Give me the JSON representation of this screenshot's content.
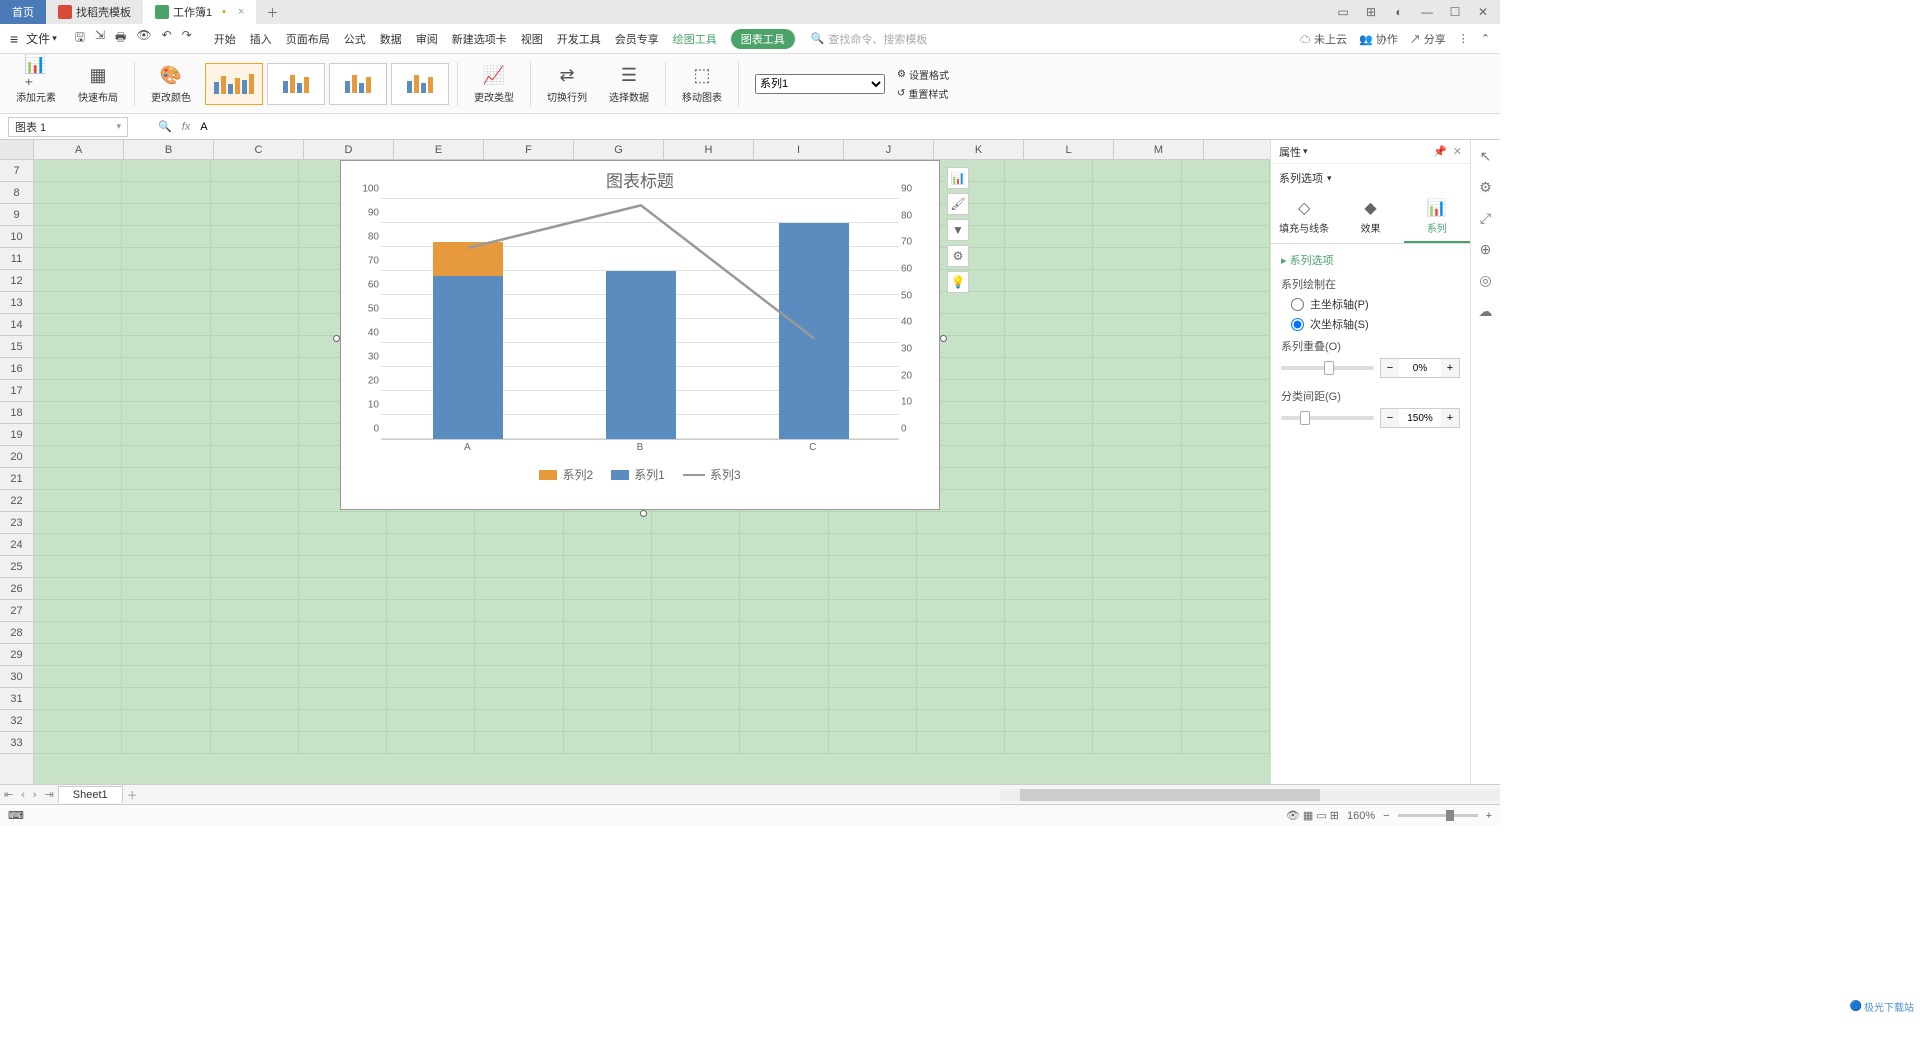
{
  "titlebar": {
    "tabs": [
      {
        "label": "首页",
        "active": true
      },
      {
        "label": "找稻壳模板",
        "icon": "red"
      },
      {
        "label": "工作簿1",
        "icon": "green",
        "modified": true
      }
    ]
  },
  "menubar": {
    "file": "文件",
    "tabs": [
      "开始",
      "插入",
      "页面布局",
      "公式",
      "数据",
      "审阅",
      "新建选项卡",
      "视图",
      "开发工具",
      "会员专享"
    ],
    "context1": "绘图工具",
    "context2": "图表工具",
    "search_placeholder": "查找命令、搜索模板",
    "cloud": "未上云",
    "coop": "协作",
    "share": "分享"
  },
  "ribbon": {
    "add_element": "添加元素",
    "quick_layout": "快速布局",
    "change_color": "更改颜色",
    "change_type": "更改类型",
    "switch_rc": "切换行列",
    "select_data": "选择数据",
    "move_chart": "移动图表",
    "set_format": "设置格式",
    "reset_style": "重置样式",
    "series_selected": "系列1"
  },
  "formula": {
    "name": "图表 1",
    "value": "A"
  },
  "columns": [
    "A",
    "B",
    "C",
    "D",
    "E",
    "F",
    "G",
    "H",
    "I",
    "J",
    "K",
    "L",
    "M"
  ],
  "rows_start": 7,
  "rows_end": 33,
  "chart_data": {
    "type": "bar",
    "title": "图表标题",
    "categories": [
      "A",
      "B",
      "C"
    ],
    "y_ticks": [
      0,
      10,
      20,
      30,
      40,
      50,
      60,
      70,
      80,
      90,
      100
    ],
    "y2_ticks": [
      0,
      10,
      20,
      30,
      40,
      50,
      60,
      70,
      80,
      90
    ],
    "series": [
      {
        "name": "系列2",
        "type": "bar",
        "color": "#e69a3c",
        "values": [
          82,
          70,
          90
        ]
      },
      {
        "name": "系列1",
        "type": "bar",
        "color": "#5b8cc0",
        "values": [
          68,
          70,
          90
        ]
      },
      {
        "name": "系列3",
        "type": "line",
        "color": "#999",
        "values": [
          72,
          88,
          38
        ],
        "axis": "secondary"
      }
    ],
    "legend": [
      "系列2",
      "系列1",
      "系列3"
    ]
  },
  "chart_tools": [
    "chart-elements",
    "brush",
    "filter",
    "gear",
    "lightbulb"
  ],
  "props": {
    "title": "属性",
    "dropdown": "系列选项",
    "tabs": {
      "fill": "填充与线条",
      "effect": "效果",
      "series": "系列"
    },
    "section": "系列选项",
    "plot_on": "系列绘制在",
    "primary": "主坐标轴(P)",
    "secondary": "次坐标轴(S)",
    "overlap": "系列重叠(O)",
    "overlap_val": "0%",
    "gap": "分类间距(G)",
    "gap_val": "150%"
  },
  "sheet_tab": "Sheet1",
  "status": {
    "zoom": "160%"
  },
  "logo": "极光下载站"
}
